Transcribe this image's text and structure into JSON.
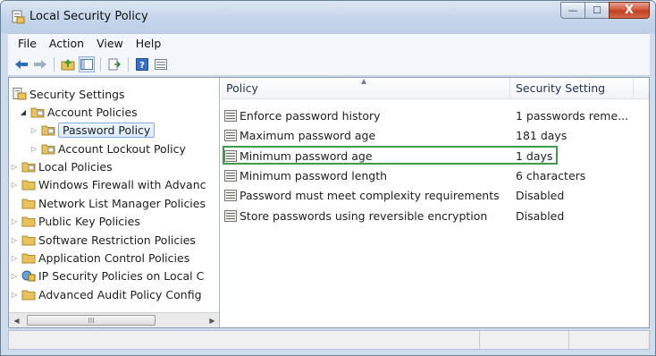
{
  "window": {
    "title": "Local Security Policy",
    "caption_buttons": {
      "minimize": "—",
      "maximize": "☐",
      "close": "X"
    }
  },
  "menu": [
    "File",
    "Action",
    "View",
    "Help"
  ],
  "toolbar_icons": [
    "back-arrow-icon",
    "forward-arrow-icon",
    "up-folder-icon",
    "show-hide-tree-icon",
    "export-list-icon",
    "help-icon",
    "properties-icon"
  ],
  "tree": {
    "root": "Security Settings",
    "items": [
      {
        "label": "Account Policies",
        "expanded": true
      },
      {
        "label": "Password Policy",
        "selected": true
      },
      {
        "label": "Account Lockout Policy"
      },
      {
        "label": "Local Policies"
      },
      {
        "label": "Windows Firewall with Advanc"
      },
      {
        "label": "Network List Manager Policies"
      },
      {
        "label": "Public Key Policies"
      },
      {
        "label": "Software Restriction Policies"
      },
      {
        "label": "Application Control Policies"
      },
      {
        "label": "IP Security Policies on Local C"
      },
      {
        "label": "Advanced Audit Policy Config"
      }
    ],
    "scroll_thumb_glyph": "III"
  },
  "list": {
    "columns": [
      "Policy",
      "Security Setting"
    ],
    "rows": [
      {
        "policy": "Enforce password history",
        "setting": "1 passwords reme..."
      },
      {
        "policy": "Maximum password age",
        "setting": "181 days"
      },
      {
        "policy": "Minimum password age",
        "setting": "1 days",
        "selected": true
      },
      {
        "policy": "Minimum password length",
        "setting": "6 characters"
      },
      {
        "policy": "Password must meet complexity requirements",
        "setting": "Disabled"
      },
      {
        "policy": "Store passwords using reversible encryption",
        "setting": "Disabled"
      }
    ]
  },
  "colors": {
    "selection_outline": "#3e9b4a",
    "folder": "#e8c25a",
    "window_frame": "#cfdcec"
  }
}
